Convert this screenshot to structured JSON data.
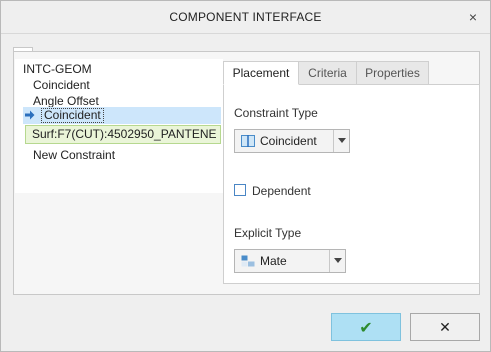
{
  "window": {
    "title": "COMPONENT INTERFACE",
    "close_glyph": "×"
  },
  "tree": {
    "root": "INTC-GEOM",
    "items": [
      {
        "label": "Coincident"
      },
      {
        "label": "Angle Offset"
      },
      {
        "label": "Coincident",
        "selected": true
      }
    ],
    "reference": "Surf:F7(CUT):4502950_PANTENE",
    "new_constraint": "New Constraint"
  },
  "tabs": [
    {
      "label": "Placement",
      "active": true
    },
    {
      "label": "Criteria",
      "active": false
    },
    {
      "label": "Properties",
      "active": false
    }
  ],
  "placement": {
    "constraint_type_label": "Constraint Type",
    "constraint_type_value": "Coincident",
    "constraint_type_icon": "coincident-icon",
    "dependent_label": "Dependent",
    "dependent_checked": false,
    "explicit_type_label": "Explicit Type",
    "explicit_type_value": "Mate",
    "explicit_type_icon": "mate-icon"
  },
  "buttons": {
    "ok_icon": "checkmark-icon",
    "cancel_icon": "close-icon",
    "ok_glyph": "✔",
    "cancel_glyph": "✕"
  },
  "colors": {
    "ok_button_bg": "#aee0f4",
    "selected_row_bg": "#cde6fb",
    "reference_bg": "#eaf5d8",
    "ok_check": "#2e8b2e"
  }
}
